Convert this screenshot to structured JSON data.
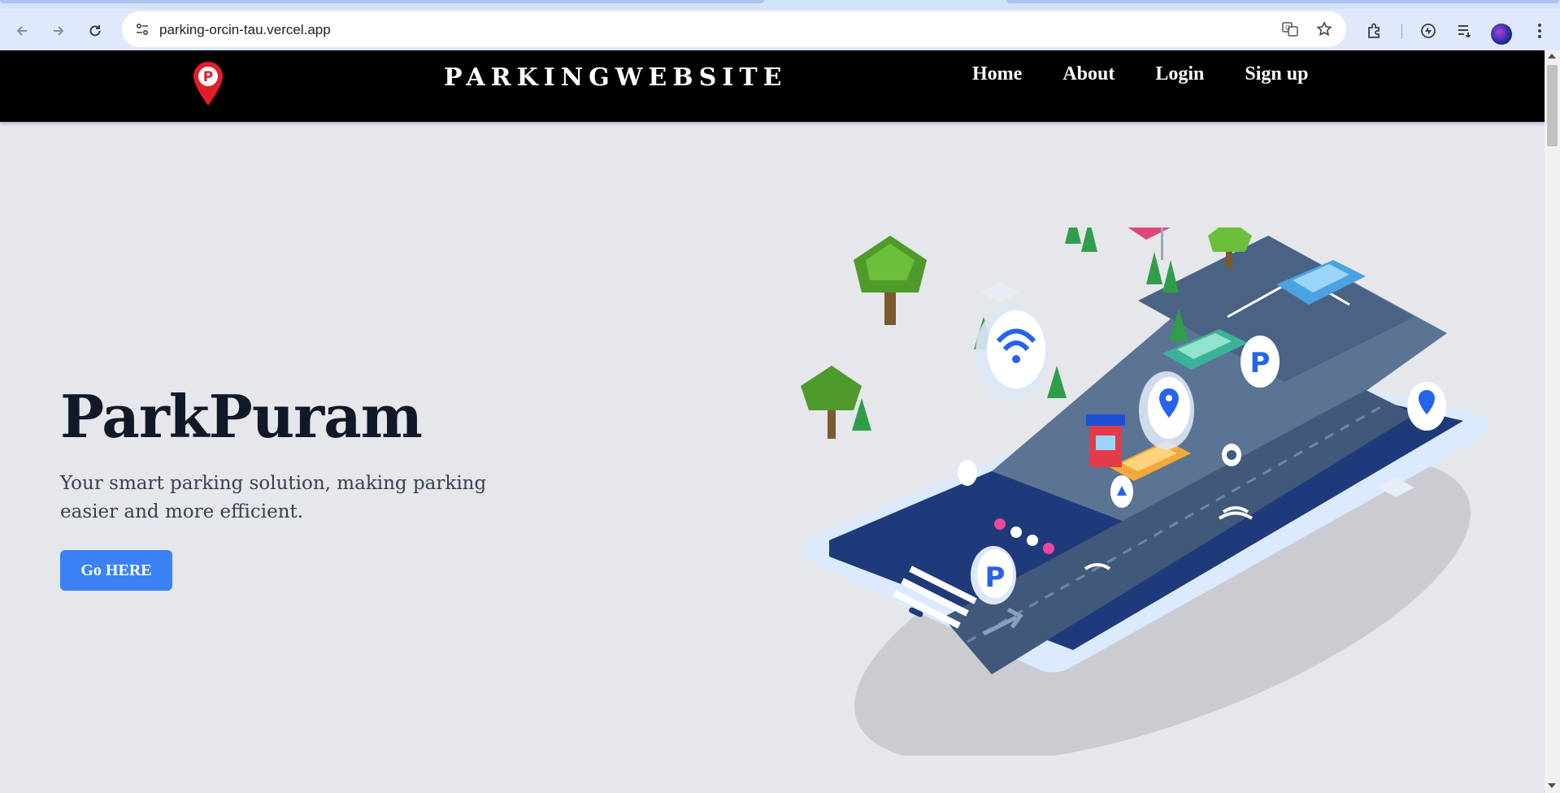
{
  "browser": {
    "url": "parking-orcin-tau.vercel.app",
    "icons": [
      "back-icon",
      "forward-icon",
      "reload-icon",
      "site-settings-icon",
      "translate-icon",
      "bookmark-star-icon",
      "extensions-icon",
      "sync-icon",
      "media-queue-icon",
      "profile-avatar",
      "more-menu-icon"
    ]
  },
  "site": {
    "brand": "PARKINGWEBSITE",
    "nav": {
      "home": "Home",
      "about": "About",
      "login": "Login",
      "signup": "Sign up"
    },
    "logo_icon": "parking-pin-icon"
  },
  "hero": {
    "title": "ParkPuram",
    "subtitle": "Your smart parking solution, making parking easier and more efficient.",
    "cta": "Go HERE",
    "illustration": "isometric-smart-parking-phone-illustration"
  },
  "colors": {
    "nav_bg": "#000000",
    "page_bg": "#e5e7eb",
    "cta_bg": "#3b82f6",
    "logo_red": "#e11d2a"
  }
}
